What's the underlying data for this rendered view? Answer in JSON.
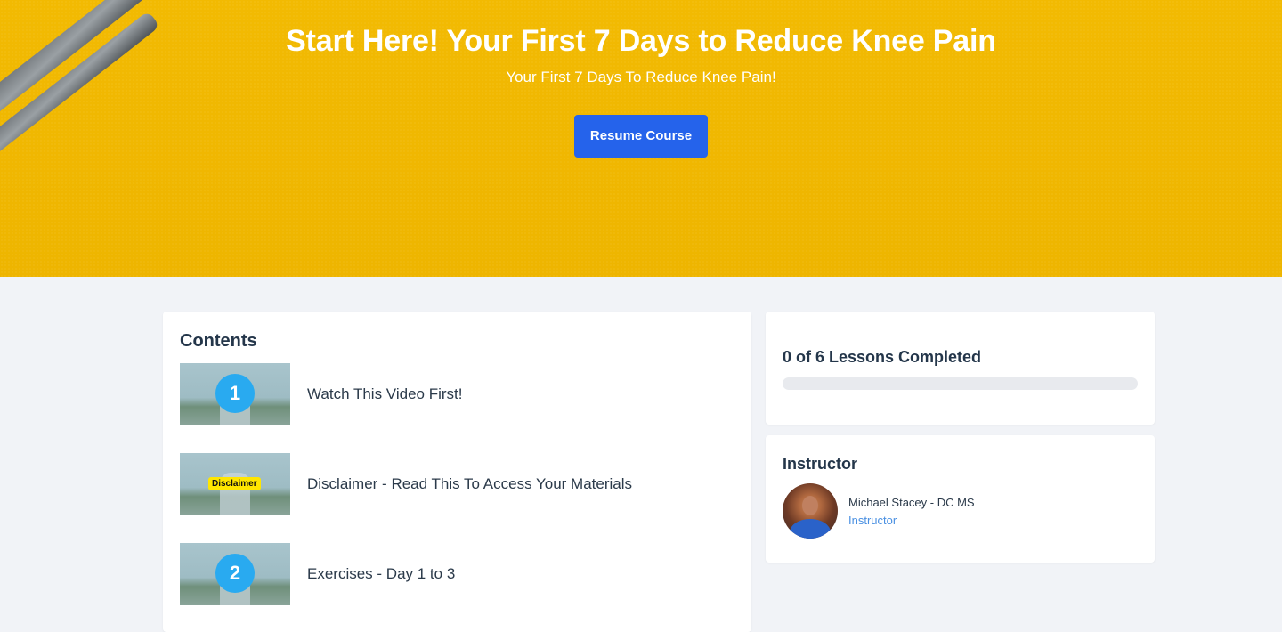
{
  "hero": {
    "title": "Start Here! Your First 7 Days to Reduce Knee Pain",
    "subtitle": "Your First 7 Days To Reduce Knee Pain!",
    "resume_label": "Resume Course",
    "background_color": "#f0b800",
    "button_color": "#2563eb"
  },
  "contents": {
    "heading": "Contents",
    "lessons": [
      {
        "title": "Watch This Video First!",
        "badge": "1"
      },
      {
        "title": "Disclaimer - Read This To Access Your Materials",
        "badge": "Disclaimer"
      },
      {
        "title": "Exercises - Day 1 to 3",
        "badge": "2"
      }
    ]
  },
  "progress": {
    "label": "0 of 6 Lessons Completed",
    "completed": 0,
    "total": 6
  },
  "instructor": {
    "heading": "Instructor",
    "name": "Michael Stacey - DC MS",
    "role": "Instructor"
  }
}
